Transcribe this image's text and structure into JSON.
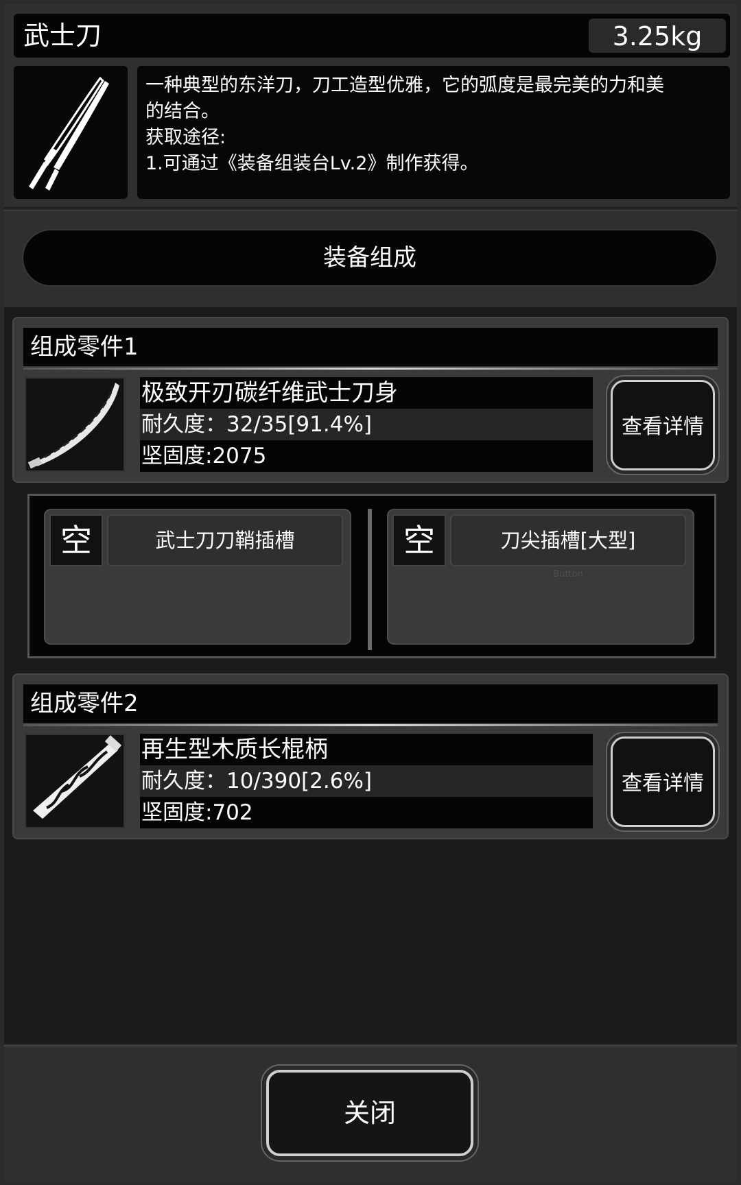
{
  "item": {
    "title": "武士刀",
    "weight": "3.25kg",
    "description_lines": [
      "一种典型的东洋刀，刀工造型优雅，它的弧度是最完美的力和美",
      "的结合。",
      "获取途径:",
      "1.可通过《装备组装台Lv.2》制作获得。"
    ],
    "icon": "katana-icon"
  },
  "section": {
    "title": "装备组成"
  },
  "parts": [
    {
      "title": "组成零件1",
      "name": "极致开刃碳纤维武士刀身",
      "durability": "耐久度：32/35[91.4%]",
      "hardness": "坚固度:2075",
      "detail_label": "查看详情",
      "icon": "blade-icon"
    },
    {
      "title": "组成零件2",
      "name": "再生型木质长棍柄",
      "durability": "耐久度：10/390[2.6%]",
      "hardness": "坚固度:702",
      "detail_label": "查看详情",
      "icon": "wooden-handle-icon"
    }
  ],
  "slots": [
    {
      "empty_label": "空",
      "name": "武士刀刀鞘插槽",
      "sub": ""
    },
    {
      "empty_label": "空",
      "name": "刀尖插槽[大型]",
      "sub": "Button"
    }
  ],
  "footer": {
    "close_label": "关闭"
  },
  "colors": {
    "background": "#2b2b2b",
    "panel_black": "#050505",
    "border_light": "#d0d0d0"
  }
}
